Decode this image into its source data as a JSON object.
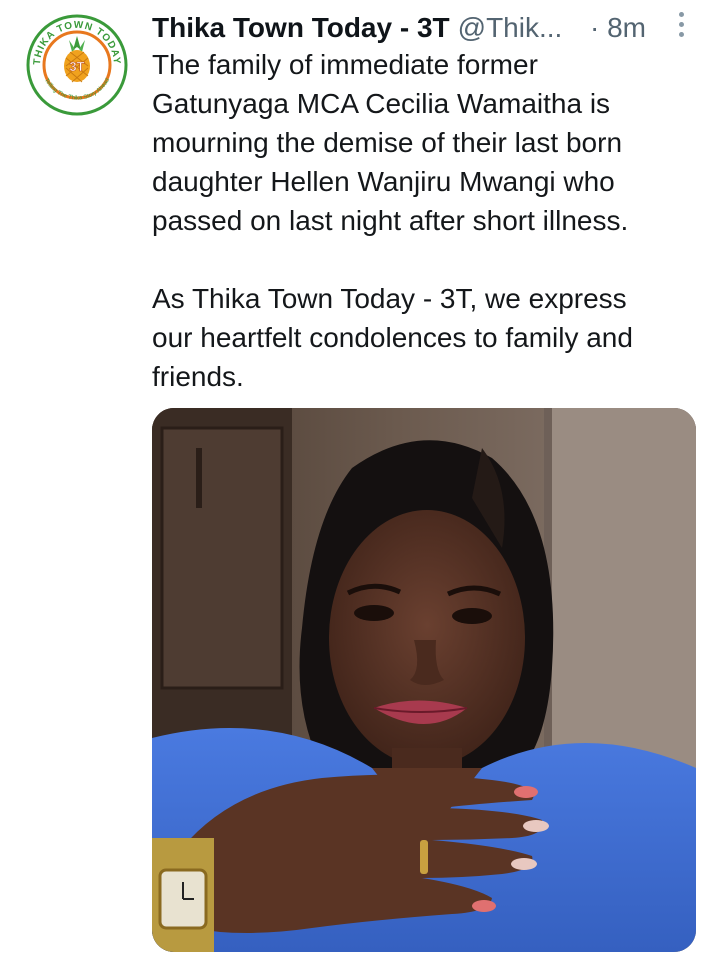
{
  "tweet": {
    "display_name": "Thika Town Today - 3T",
    "handle": "@Thik...",
    "time": "· 8m",
    "text_paragraph_1": "The family of immediate former\nGatunyaga MCA Cecilia Wamaitha is\nmourning the demise of their last born\ndaughter Hellen Wanjiru Mwangi who\npassed on last night after short illness.",
    "text_paragraph_2": "As Thika Town Today - 3T, we express\nour heartfelt condolences to family and\nfriends."
  },
  "avatar": {
    "logo_text": "3T",
    "ring_text": "THIKA TOWN TODAY",
    "tagline": "Telling The Thika Story Ahead"
  },
  "colors": {
    "text": "#0f1419",
    "secondary_text": "#536471",
    "logo_green": "#3a9a3a",
    "logo_orange": "#e8781e",
    "shirt_blue": "#3f6fd0"
  },
  "icons": {
    "more": "more-vertical-icon"
  }
}
